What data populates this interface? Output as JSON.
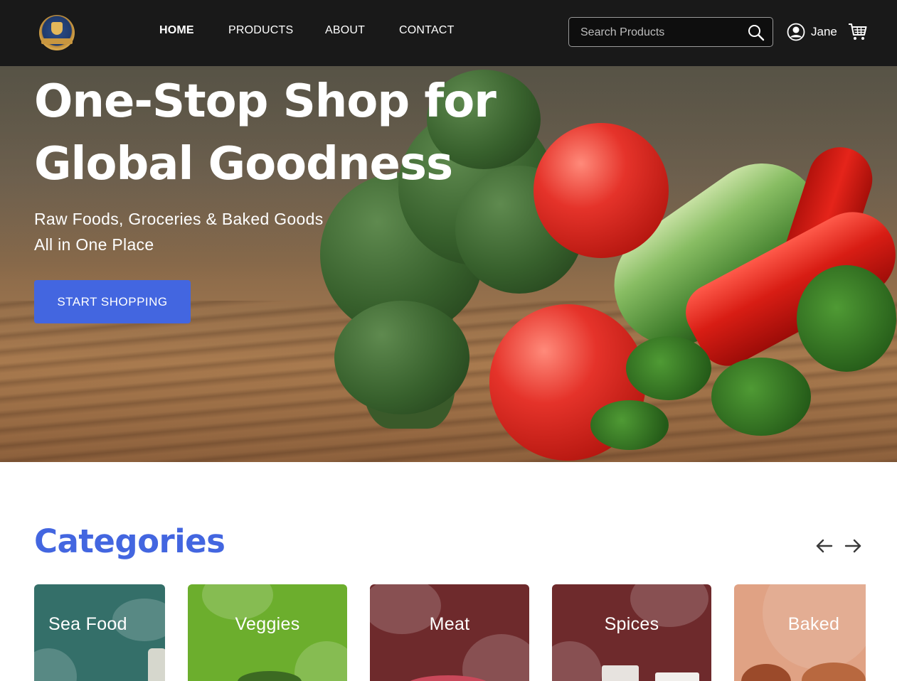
{
  "header": {
    "nav": [
      {
        "label": "HOME",
        "active": true
      },
      {
        "label": "PRODUCTS",
        "active": false
      },
      {
        "label": "ABOUT",
        "active": false
      },
      {
        "label": "CONTACT",
        "active": false
      }
    ],
    "search_placeholder": "Search Products",
    "user_name": "Jane"
  },
  "hero": {
    "title_line1": "One-Stop Shop for",
    "title_line2": "Global Goodness",
    "subtitle_line1": "Raw Foods, Groceries & Baked Goods",
    "subtitle_line2": "All in One Place",
    "cta_label": "START SHOPPING"
  },
  "categories": {
    "title": "Categories",
    "items": [
      {
        "label": "Sea Food",
        "color": "#346f69"
      },
      {
        "label": "Veggies",
        "color": "#6cae2d"
      },
      {
        "label": "Meat",
        "color": "#6e2a2c"
      },
      {
        "label": "Spices",
        "color": "#6e2a2c"
      },
      {
        "label": "Baked",
        "color": "#e0a284"
      }
    ]
  },
  "colors": {
    "header_bg": "#191919",
    "accent": "#4366e0"
  }
}
